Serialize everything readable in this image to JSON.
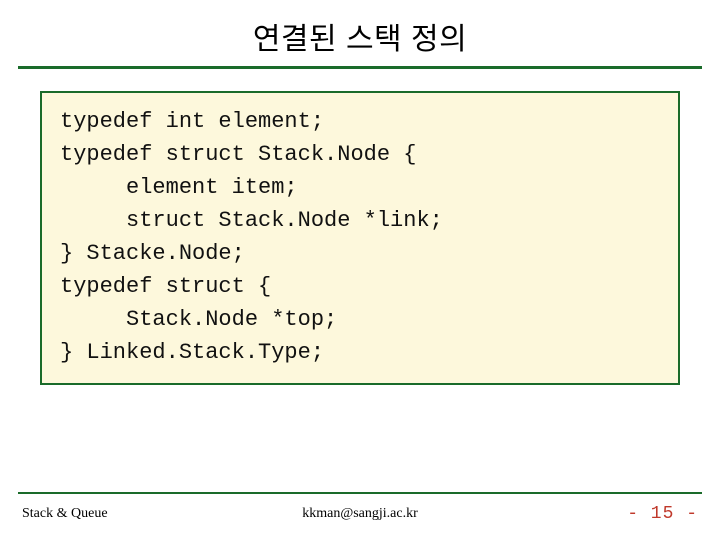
{
  "title": "연결된 스택 정의",
  "code": {
    "l01": "typedef int element;",
    "l02": "",
    "l03": "typedef struct Stack.Node {",
    "l04": "     element item;",
    "l05": "     struct Stack.Node *link;",
    "l06": "} Stacke.Node;",
    "l07": "",
    "l08": "typedef struct {",
    "l09": "     Stack.Node *top;",
    "l10": "} Linked.Stack.Type;"
  },
  "footer": {
    "left": "Stack & Queue",
    "center": "kkman@sangji.ac.kr",
    "right": "- 15 -"
  }
}
